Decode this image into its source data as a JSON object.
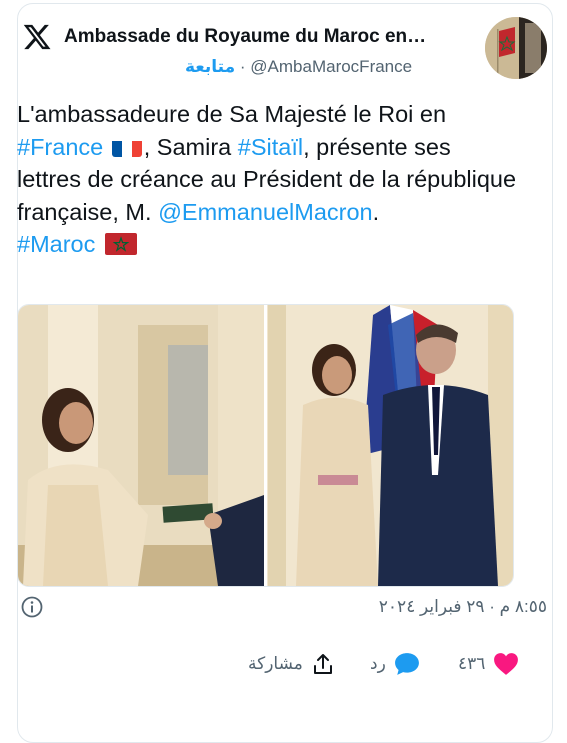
{
  "tweet": {
    "author_name": "Ambassade du Royaume du Maroc en…",
    "follow_label": "متابعة",
    "separator": "·",
    "handle": "@AmbaMarocFrance",
    "text_1": "L'ambassadeure de Sa Majesté le Roi en",
    "hashtag_france": "#France",
    "text_2": ", Samira",
    "hashtag_sitail": "#Sitaïl",
    "text_3": ", présente ses lettres de créance au Président de la république française, M.",
    "mention": "@EmmanuelMacron",
    "text_4": ".",
    "hashtag_maroc": "#Maroc",
    "timestamp": "٨:٥٥ م · ٢٩ فبراير ٢٠٢٤"
  },
  "actions": {
    "likes_count": "٤٣٦",
    "reply_label": "رد",
    "share_label": "مشاركة"
  },
  "icons": {
    "logo": "x-logo-icon",
    "info": "info-icon",
    "heart": "heart-icon",
    "reply": "reply-bubble-icon",
    "share": "share-icon"
  },
  "colors": {
    "link": "#1d9bf0",
    "heart": "#f91880",
    "secondary_text": "#536471",
    "reply_bubble": "#1d9bf0"
  }
}
